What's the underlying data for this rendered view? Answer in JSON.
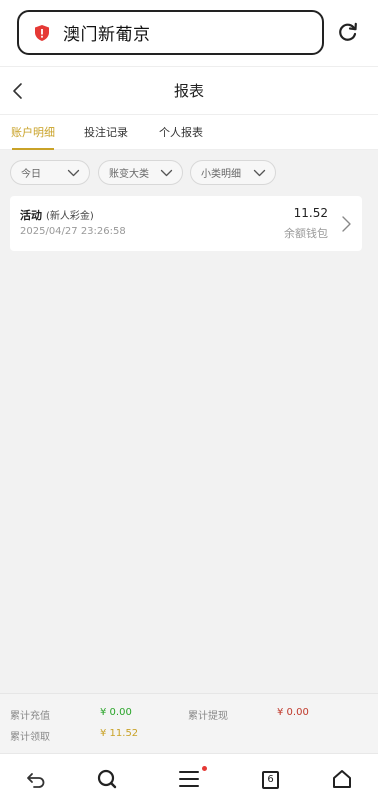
{
  "browser": {
    "address_text": "澳门新葡京",
    "tabs_count": "6"
  },
  "header": {
    "title": "报表"
  },
  "tabs": [
    {
      "label": "账户明细",
      "active": true
    },
    {
      "label": "投注记录",
      "active": false
    },
    {
      "label": "个人报表",
      "active": false
    }
  ],
  "filters": [
    {
      "label": "今日"
    },
    {
      "label": "账变大类"
    },
    {
      "label": "小类明细"
    }
  ],
  "records": [
    {
      "title": "活动",
      "subtitle": "(新人彩金)",
      "time": "2025/04/27 23:26:58",
      "amount": "11.52",
      "wallet": "余额钱包"
    }
  ],
  "summary": {
    "recharge_label": "累计充值",
    "recharge_value": "¥ 0.00",
    "withdraw_label": "累计提现",
    "withdraw_value": "¥ 0.00",
    "claim_label": "累计领取",
    "claim_value": "¥ 11.52"
  },
  "colors": {
    "accent": "#c9a227",
    "positive": "#2aa52a",
    "negative": "#c0392b"
  }
}
